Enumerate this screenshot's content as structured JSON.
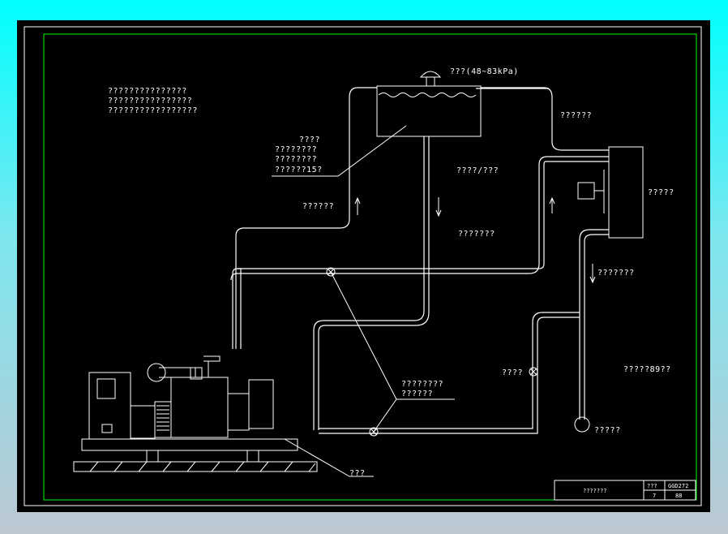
{
  "drawing": {
    "pressure_cap": "???(48~83kPa)",
    "note_lines": [
      "???????????????",
      "????????????????",
      "?????????????????"
    ],
    "tank_notes": [
      "????",
      "????????",
      "????????",
      "??????15?"
    ],
    "label_radiator_inlet": "??????",
    "label_radiator": "?????",
    "label_rising_left": "??????",
    "label_center_top": "????/???",
    "label_center_mid": "???????",
    "label_right_down": "???????",
    "label_valve_right": "????",
    "label_right_low": "?????89??",
    "valve_note": [
      "????????",
      "??????"
    ],
    "label_pump": "?????",
    "label_base": "???"
  },
  "title_block": {
    "name": "???????",
    "field_label": "???",
    "code": "GGD272",
    "sheet": "7",
    "page": "88"
  },
  "colors": {
    "background": "#000000",
    "frame": "#ffffff",
    "border": "#00ff00",
    "lines": "#ffffff"
  }
}
